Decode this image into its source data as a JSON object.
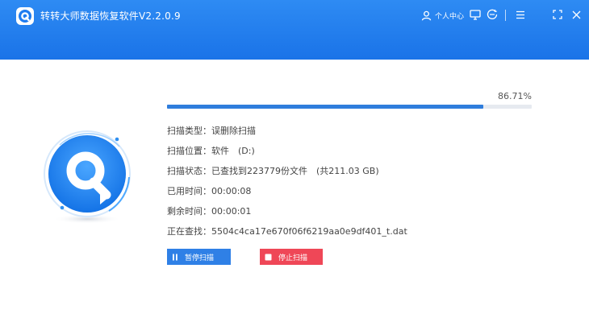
{
  "window": {
    "title": "转转大师数据恢复软件V2.2.0.9",
    "user_center": "个人中心"
  },
  "colors": {
    "header": "#1a73e8",
    "progress": "#2f7ddc",
    "pause_button": "#2f80e6",
    "stop_button": "#ef4757"
  },
  "progress": {
    "percent_text": "86.71%",
    "fraction": 0.8671
  },
  "scan": {
    "type_label": "扫描类型：",
    "type_value": "误删除扫描",
    "location_label": "扫描位置：",
    "location_value": "软件　(D:)",
    "status_label": "扫描状态：",
    "status_value": "已查找到223779份文件　(共211.03 GB)",
    "elapsed_label": "已用时间：",
    "elapsed_value": "00:00:08",
    "remaining_label": "剩余时间：",
    "remaining_value": "00:00:01",
    "current_label": "正在查找：",
    "current_value": "5504c4ca17e670f06f6219aa0e9df401_t.dat"
  },
  "buttons": {
    "pause": "暂停扫描",
    "stop": "停止扫描"
  },
  "icons": {
    "logo": "app-logo-icon",
    "user": "user-icon",
    "monitor": "monitor-icon",
    "feedback": "feedback-icon",
    "menu": "menu-icon",
    "maximize": "maximize-icon",
    "close": "close-icon",
    "pause": "pause-icon",
    "stop": "stop-icon"
  }
}
